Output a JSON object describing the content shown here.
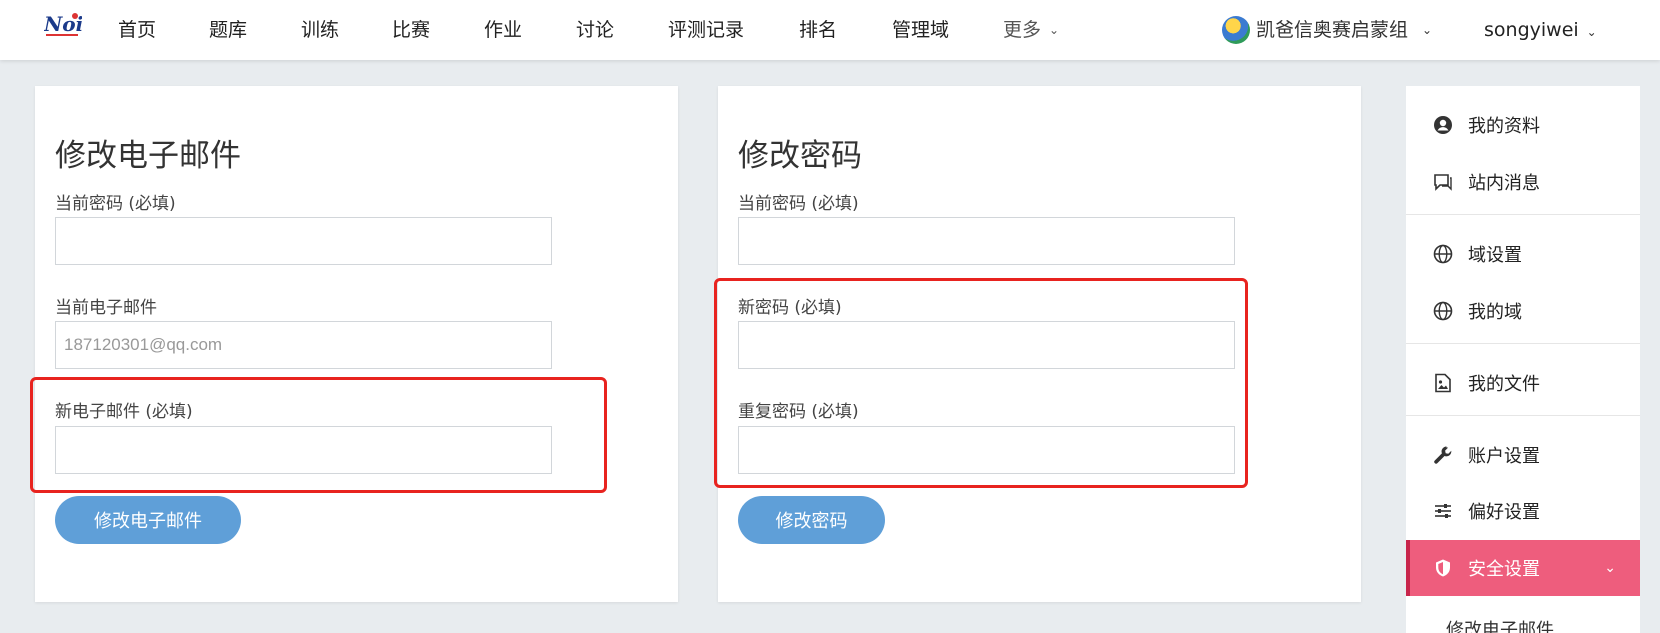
{
  "nav": {
    "items": [
      "首页",
      "题库",
      "训练",
      "比赛",
      "作业",
      "讨论",
      "评测记录",
      "排名",
      "管理域"
    ],
    "more_label": "更多",
    "domain_label": "凯爸信奥赛启蒙组",
    "user_label": "songyiwei"
  },
  "email_card": {
    "title": "修改电子邮件",
    "current_password_label": "当前密码 (必填)",
    "current_email_label": "当前电子邮件",
    "current_email_value": "187120301@qq.com",
    "new_email_label": "新电子邮件 (必填)",
    "submit_label": "修改电子邮件"
  },
  "password_card": {
    "title": "修改密码",
    "current_password_label": "当前密码 (必填)",
    "new_password_label": "新密码 (必填)",
    "repeat_password_label": "重复密码 (必填)",
    "submit_label": "修改密码"
  },
  "sidebar": {
    "items": [
      {
        "label": "我的资料",
        "icon": "user-circle-icon"
      },
      {
        "label": "站内消息",
        "icon": "chat-icon"
      },
      {
        "label": "域设置",
        "icon": "globe-icon"
      },
      {
        "label": "我的域",
        "icon": "globe-icon"
      },
      {
        "label": "我的文件",
        "icon": "file-image-icon"
      },
      {
        "label": "账户设置",
        "icon": "wrench-icon"
      },
      {
        "label": "偏好设置",
        "icon": "sliders-icon"
      },
      {
        "label": "安全设置",
        "icon": "shield-icon"
      }
    ],
    "active_sub_label": "修改电子邮件"
  },
  "colors": {
    "accent_button": "#5f9fd8",
    "active_sidebar": "#ee5d7d",
    "highlight_border": "#e8231f"
  }
}
